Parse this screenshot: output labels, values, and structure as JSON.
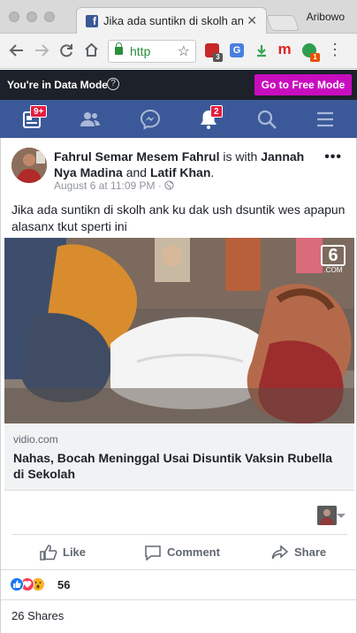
{
  "browser": {
    "tab_title": "Jika ada suntikn di skolh ank ku dak ush dsuntik wes apapun alasanx tkut sperti ini",
    "tab_close": "✕",
    "profile_name": "Aribowo",
    "url": "http",
    "extensions": [
      {
        "icon": "shield-extension-icon",
        "badge": "3",
        "color": "#c62828"
      },
      {
        "icon": "translate-extension-icon",
        "badge": "",
        "color": "#4a7fe0"
      },
      {
        "icon": "download-extension-icon",
        "badge": "",
        "color": "#3aa357"
      },
      {
        "icon": "m-extension-icon",
        "label": "m",
        "badge": "",
        "color": "#e02424"
      },
      {
        "icon": "green-extension-icon",
        "badge": "1",
        "color": "#2e9e4f"
      }
    ]
  },
  "data_mode": {
    "text": "You're in Data Mode",
    "help": "?",
    "button": "Go to Free Mode",
    "button_color": "#c80dbf"
  },
  "fb_nav": {
    "color": "#3b5998",
    "items": [
      {
        "icon": "news-feed-icon",
        "badge": "9+"
      },
      {
        "icon": "friends-icon",
        "badge": ""
      },
      {
        "icon": "messenger-icon",
        "badge": ""
      },
      {
        "icon": "notifications-bell-icon",
        "badge": "2"
      },
      {
        "icon": "search-icon",
        "badge": ""
      },
      {
        "icon": "menu-icon",
        "badge": ""
      }
    ]
  },
  "post": {
    "author": "Fahrul Semar Mesem Fahrul",
    "with_text": " is with ",
    "tagged_1": "Jannah Nya Madina",
    "and_text": " and ",
    "tagged_2": "Latif Khan",
    "end_text": ".",
    "timestamp": "August 6 at 11:09 PM",
    "separator": "·",
    "text": "Jika ada suntikn di skolh ank ku dak ush dsuntik wes apapun alasanx tkut sperti ini",
    "image_watermark": "6",
    "image_watermark_sub": ".COM",
    "link": {
      "domain": "vidio.com",
      "title": "Nahas, Bocah Meninggal Usai Disuntik Vaksin Rubella di Sekolah"
    },
    "actions": {
      "like": "Like",
      "comment": "Comment",
      "share": "Share"
    },
    "reaction_count": "56",
    "shares": "26 Shares"
  }
}
